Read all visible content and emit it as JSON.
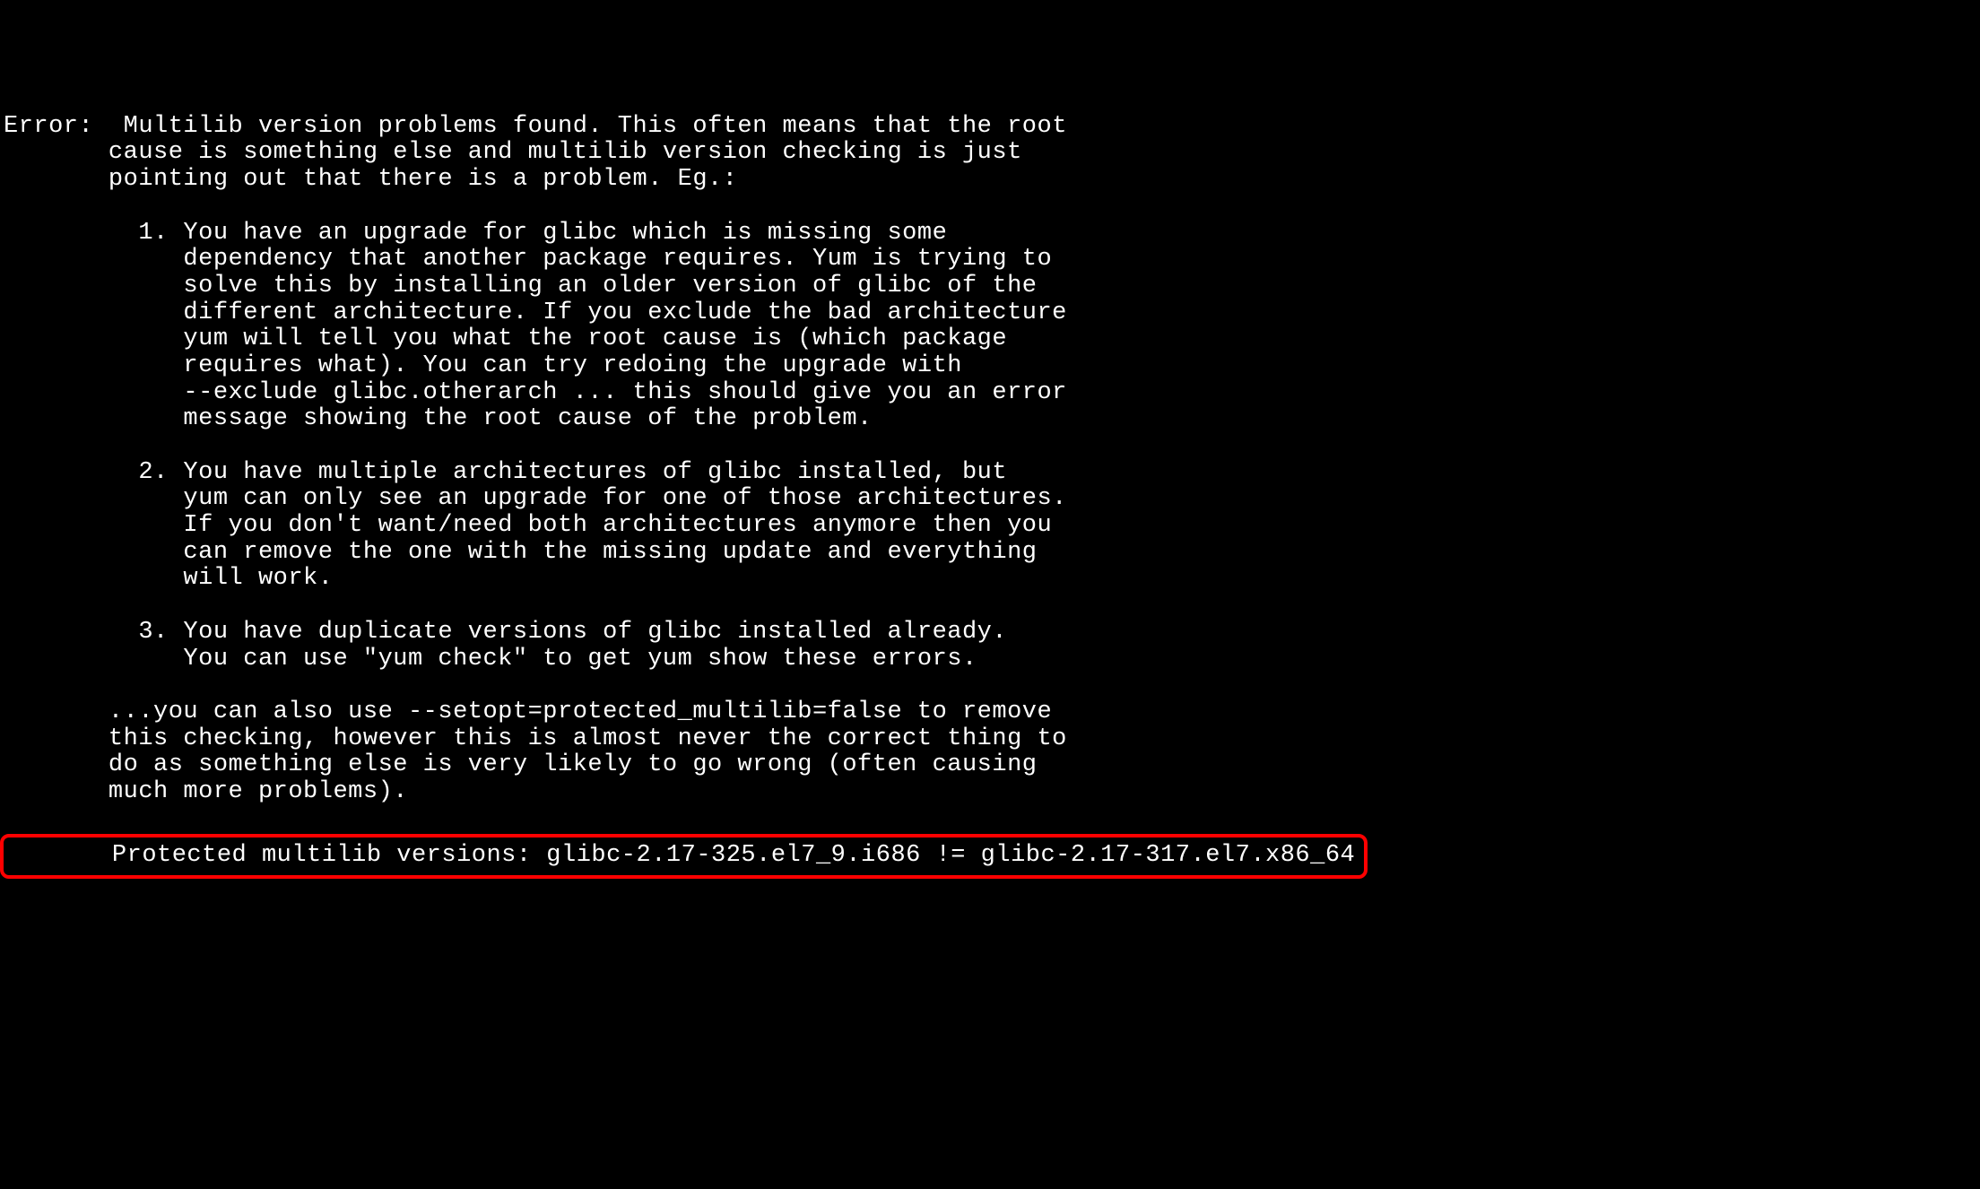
{
  "terminal": {
    "error_prefix": "Error:",
    "intro_line1": "  Multilib version problems found. This often means that the root",
    "intro_line2": "       cause is something else and multilib version checking is just",
    "intro_line3": "       pointing out that there is a problem. Eg.:",
    "item1_num": "         1.",
    "item1_line1": " You have an upgrade for glibc which is missing some",
    "item1_line2": "            dependency that another package requires. Yum is trying to",
    "item1_line3": "            solve this by installing an older version of glibc of the",
    "item1_line4": "            different architecture. If you exclude the bad architecture",
    "item1_line5": "            yum will tell you what the root cause is (which package",
    "item1_line6": "            requires what). You can try redoing the upgrade with",
    "item1_line7": "            --exclude glibc.otherarch ... this should give you an error",
    "item1_line8": "            message showing the root cause of the problem.",
    "item2_num": "         2.",
    "item2_line1": " You have multiple architectures of glibc installed, but",
    "item2_line2": "            yum can only see an upgrade for one of those architectures.",
    "item2_line3": "            If you don't want/need both architectures anymore then you",
    "item2_line4": "            can remove the one with the missing update and everything",
    "item2_line5": "            will work.",
    "item3_num": "         3.",
    "item3_line1": " You have duplicate versions of glibc installed already.",
    "item3_line2": "            You can use \"yum check\" to get yum show these errors.",
    "footer_line1": "       ...you can also use --setopt=protected_multilib=false to remove",
    "footer_line2": "       this checking, however this is almost never the correct thing to",
    "footer_line3": "       do as something else is very likely to go wrong (often causing",
    "footer_line4": "       much more problems).",
    "highlighted": "       Protected multilib versions: glibc-2.17-325.el7_9.i686 != glibc-2.17-317.el7.x86_64"
  }
}
